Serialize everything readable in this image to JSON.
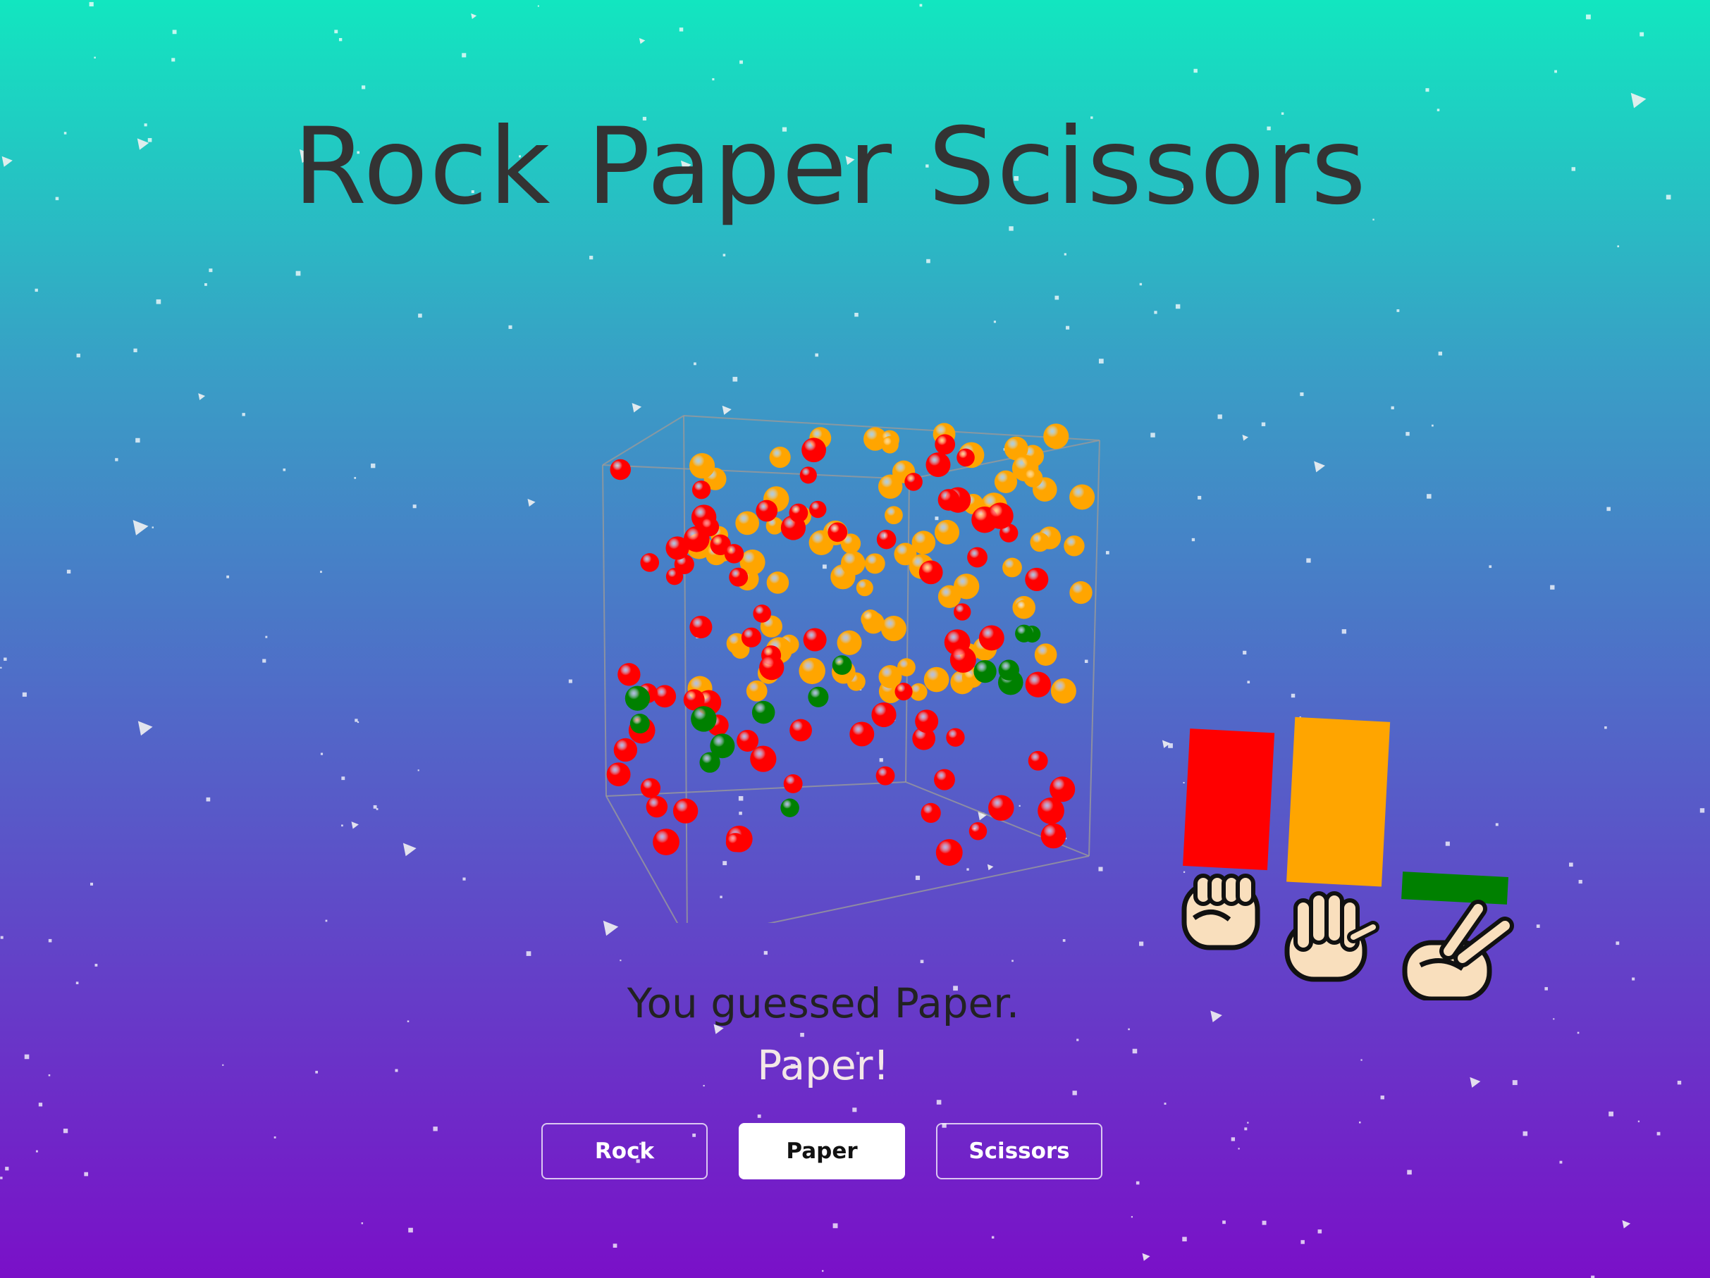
{
  "title": "Rock Paper Scissors",
  "guess_text": "You guessed Paper.",
  "result_text": "Paper!",
  "buttons": [
    {
      "label": "Rock",
      "selected": false
    },
    {
      "label": "Paper",
      "selected": true
    },
    {
      "label": "Scissors",
      "selected": false
    }
  ],
  "colors": {
    "rock": "#ff0000",
    "paper": "#ffa500",
    "scissors": "#008000",
    "cube_edge": "#9a9a9a"
  },
  "icons": [
    "raised-fist-icon",
    "raised-hand-icon",
    "victory-hand-icon"
  ],
  "chart_data": {
    "type": "bar",
    "categories": [
      "rock-icon",
      "paper-icon",
      "scissors-icon"
    ],
    "values": [
      65,
      78,
      13
    ]
  }
}
